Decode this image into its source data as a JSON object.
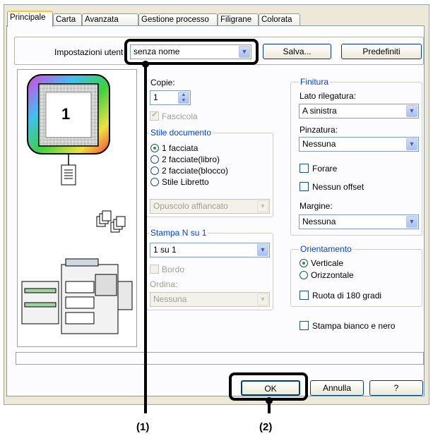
{
  "tabs": [
    "Principale",
    "Carta",
    "Avanzata",
    "Gestione processo",
    "Filigrane",
    "Colorata"
  ],
  "user_settings": {
    "label": "Impostazioni utent",
    "value": "senza nome",
    "save_label": "Salva...",
    "default_label": "Predefiniti"
  },
  "preview": {
    "page_number": "1"
  },
  "copies": {
    "label": "Copie:",
    "value": "1"
  },
  "collate": {
    "label": "Fascicola"
  },
  "doc_style": {
    "title": "Stile documento",
    "options": [
      "1 facciata",
      "2 facciate(libro)",
      "2 facciate(blocco)",
      "Stile Libretto"
    ],
    "selected": "1 facciata",
    "booklet_value": "Opuscolo affiancato"
  },
  "n_up": {
    "title": "Stampa N su 1",
    "value": "1 su 1",
    "border_label": "Bordo",
    "order_label": "Ordina:",
    "order_value": "Nessuna"
  },
  "finishing": {
    "title": "Finitura",
    "binding_label": "Lato rilegatura:",
    "binding_value": "A sinistra",
    "staple_label": "Pinzatura:",
    "staple_value": "Nessuna",
    "punch_label": "Forare",
    "offset_label": "Nessun offset",
    "margin_label": "Margine:",
    "margin_value": "Nessuna"
  },
  "orientation": {
    "title": "Orientamento",
    "options": [
      "Verticale",
      "Orizzontale"
    ],
    "selected": "Verticale",
    "rotate_label": "Ruota di 180 gradi"
  },
  "bw_label": "Stampa bianco e nero",
  "buttons": {
    "ok": "OK",
    "cancel": "Annulla",
    "help": "?"
  },
  "callouts": [
    "(1)",
    "(2)"
  ],
  "colors": {
    "accent": "#0046d5",
    "tab_highlight": "#ffc83c",
    "panel_bg": "#fcfcfe",
    "dialog_bg": "#ece9d8"
  }
}
